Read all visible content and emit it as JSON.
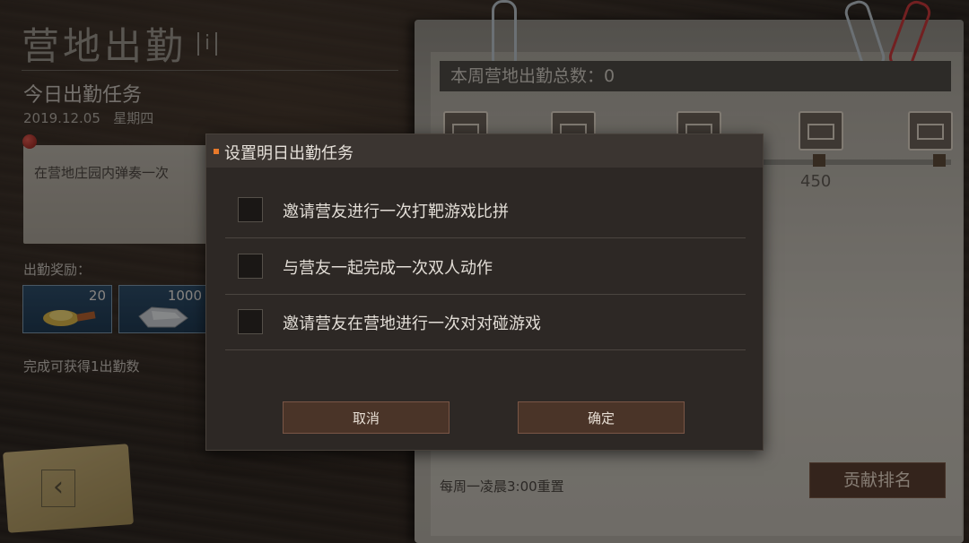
{
  "left_panel": {
    "title": "营地出勤",
    "info_icon": "i",
    "task_heading": "今日出勤任务",
    "date": "2019.12.05",
    "weekday": "星期四",
    "task_text": "在营地庄园内弹奏一次",
    "reward_label": "出勤奖励：",
    "rewards": [
      {
        "count": "20",
        "icon": "gold-turtle-icon"
      },
      {
        "count": "1000",
        "icon": "silver-ore-icon"
      }
    ],
    "reward_note": "完成可获得1出勤数",
    "back_icon": "chevron-left-icon"
  },
  "right_panel": {
    "total_label": "本周营地出勤总数：0",
    "milestone_labels": [
      "450"
    ],
    "reset_note": "每周一凌晨3:00重置",
    "rank_button": "贡献排名"
  },
  "dialog": {
    "title": "设置明日出勤任务",
    "options": [
      {
        "label": "邀请营友进行一次打靶游戏比拼",
        "checked": false
      },
      {
        "label": "与营友一起完成一次双人动作",
        "checked": false
      },
      {
        "label": "邀请营友在营地进行一次对对碰游戏",
        "checked": false
      }
    ],
    "cancel": "取消",
    "confirm": "确定"
  },
  "colors": {
    "accent": "#e8792a",
    "button_bg": "#4a3428"
  }
}
